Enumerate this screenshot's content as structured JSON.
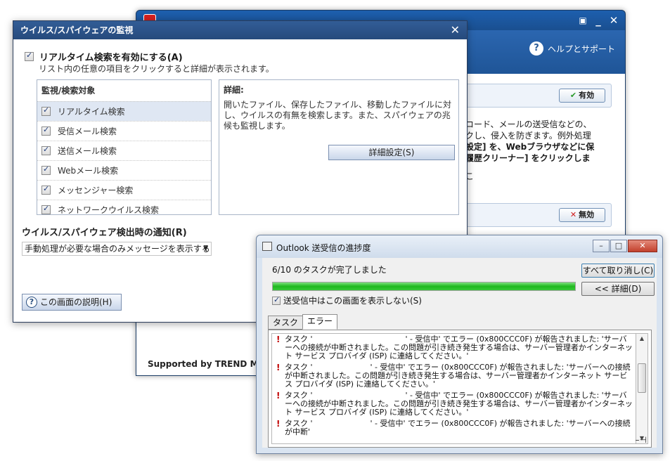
{
  "back_window": {
    "help_label": "ヘルプとサポート",
    "status_on": "有効",
    "status_off": "無効",
    "text_lines": [
      "コード、メールの送受信などの、",
      "クし、侵入を防ぎます。例外処理",
      "設定] を、Webブラウザなどに保",
      "履歴クリーナー] をクリックしま",
      "こ"
    ],
    "supported_by": "Supported by TREND MICR"
  },
  "monitor": {
    "title": "ウイルス/スパイウェアの監視",
    "close_glyph": "✕",
    "realtime_label": "リアルタイム検索を有効にする(A)",
    "hint": "リスト内の任意の項目をクリックすると詳細が表示されます。",
    "list_header": "監視/検索対象",
    "items": [
      {
        "label": "リアルタイム検索"
      },
      {
        "label": "受信メール検索"
      },
      {
        "label": "送信メール検索"
      },
      {
        "label": "Webメール検索"
      },
      {
        "label": "メッセンジャー検索"
      },
      {
        "label": "ネットワークウイルス検索"
      }
    ],
    "detail_label": "詳細:",
    "detail_text": "開いたファイル、保存したファイル、移動したファイルに対し、ウイルスの有無を検索します。また、スパイウェアの兆候も監視します。",
    "detail_button": "詳細設定(S)",
    "notify_label": "ウイルス/スパイウェア検出時の通知(R)",
    "notify_value": "手動処理が必要な場合のみメッセージを表示する",
    "explain_button": "この画面の説明(H)"
  },
  "outlook": {
    "title": "Outlook 送受信の進捗度",
    "progress_text": "6/10 のタスクが完了しました",
    "progress_percent": 100,
    "cancel_all": "すべて取り消し(C)",
    "details_toggle": "<< 詳細(D)",
    "hide_label": "送受信中はこの画面を表示しない(S)",
    "tabs": [
      "タスク",
      "エラー"
    ],
    "task_label": "タスク '",
    "errors": [
      {
        "after": "' - 受信中' でエラー (0x800CCC0F) が報告されました: 'サーバーへの接続が中断されました。この問題が引き続き発生する場合は、サーバー管理者かインターネット サービス プロバイダ (ISP) に連絡してください。'"
      },
      {
        "after": "' - 受信中' でエラー (0x800CCC0F) が報告されました: 'サーバーへの接続が中断されました。この問題が引き続き発生する場合は、サーバー管理者かインターネット サービス プロバイダ (ISP) に連絡してください。'"
      },
      {
        "after": "' - 受信中' でエラー (0x800CCC0F) が報告されました: 'サーバーへの接続が中断されました。この問題が引き続き発生する場合は、サーバー管理者かインターネット サービス プロバイダ (ISP) に連絡してください。'"
      },
      {
        "after": "' - 受信中' でエラー (0x800CCC0F) が報告されました: 'サーバーへの接続が中断'"
      }
    ]
  }
}
